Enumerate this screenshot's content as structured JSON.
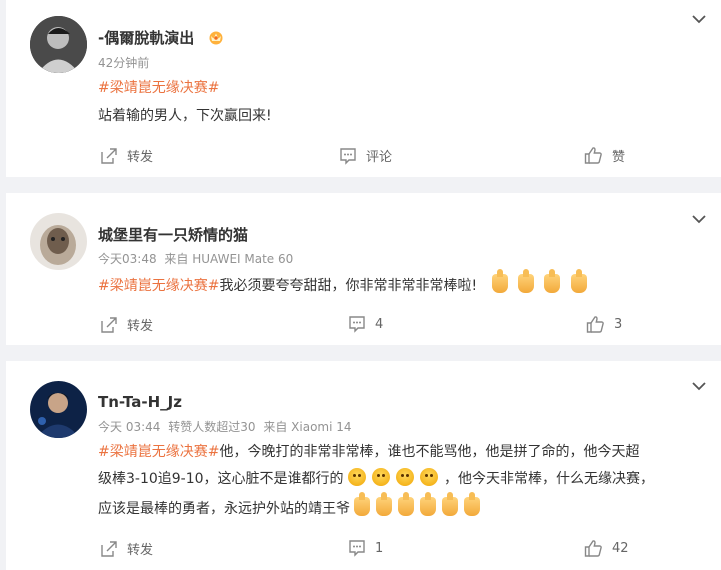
{
  "comments": [
    {
      "username": "-偶爾脫軌演出",
      "time": "42分钟前",
      "source": "",
      "hashtag": "#梁靖崑无缘决赛#",
      "text": "站着输的男人，下次赢回来!",
      "actions": {
        "repost": "转发",
        "comment": "评论",
        "like": "赞"
      }
    },
    {
      "username": "城堡里有一只矫情的猫",
      "time": "今天03:48",
      "source": "来自 HUAWEI Mate 60",
      "hashtag": "#梁靖崑无缘决赛#",
      "text": "我必须要夸夸甜甜，你非常非常非常棒啦!",
      "actions": {
        "repost": "转发",
        "comment": "4",
        "like": "3"
      }
    },
    {
      "username": "Tn-Ta-H_Jz",
      "time": "今天 03:44",
      "likes_note": "转赞人数超过30",
      "source": "来自 Xiaomi 14",
      "hashtag": "#梁靖崑无缘决赛#",
      "line1": "他，今晚打的非常非常棒，谁也不能骂他，他是拼了命的，他今天超",
      "line2a": "级棒3-10追9-10，这心脏不是谁都行的",
      "line2b": "，他今天非常棒，什么无缘决赛，",
      "line3": "应该是最棒的勇者，永远护外站的靖王爷",
      "actions": {
        "repost": "转发",
        "comment": "1",
        "like": "42"
      }
    }
  ],
  "icons": {
    "expand": "chevron-down-icon",
    "repost": "share-icon",
    "comment": "comment-icon",
    "like": "thumbs-up-icon",
    "verified": "crown-badge-icon",
    "emoji_thumb": "thumbs-up-emoji",
    "emoji_angry": "angry-face-emoji"
  },
  "colors": {
    "hashtag": "#eb7340",
    "meta": "#939393",
    "background": "#f1f2f5"
  }
}
